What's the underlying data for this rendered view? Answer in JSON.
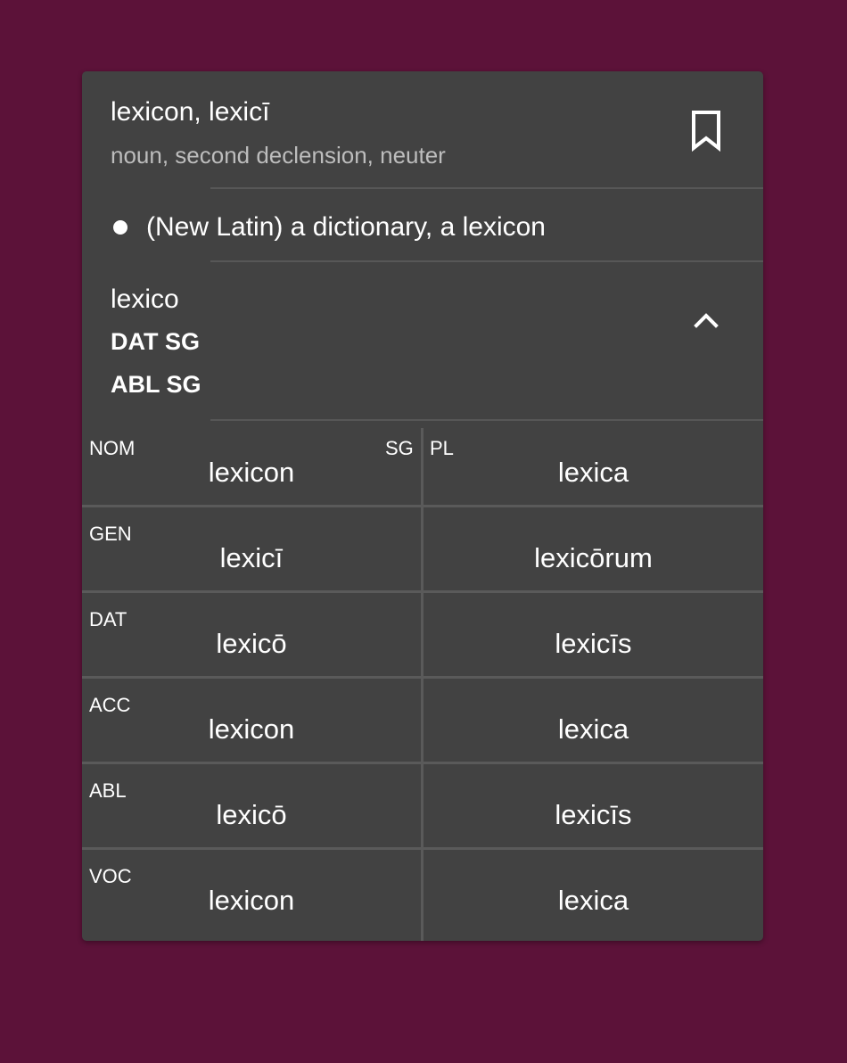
{
  "entry": {
    "headword": "lexicon, lexicī",
    "part_of_speech": "noun, second declension, neuter",
    "bookmark_icon": "bookmark-outline-icon"
  },
  "definitions": [
    "(New Latin) a dictionary, a lexicon"
  ],
  "form": {
    "word": "lexico",
    "tags": [
      "DAT SG",
      "ABL SG"
    ],
    "toggle_icon": "chevron-up-icon"
  },
  "table": {
    "sg_header": "SG",
    "pl_header": "PL",
    "rows": [
      {
        "case": "NOM",
        "sg": "lexicon",
        "pl": "lexica"
      },
      {
        "case": "GEN",
        "sg": "lexicī",
        "pl": "lexicōrum"
      },
      {
        "case": "DAT",
        "sg": "lexicō",
        "pl": "lexicīs"
      },
      {
        "case": "ACC",
        "sg": "lexicon",
        "pl": "lexica"
      },
      {
        "case": "ABL",
        "sg": "lexicō",
        "pl": "lexicīs"
      },
      {
        "case": "VOC",
        "sg": "lexicon",
        "pl": "lexica"
      }
    ]
  },
  "colors": {
    "background": "#5c1239",
    "card": "#424242",
    "secondary_text": "#bdbdbd"
  }
}
